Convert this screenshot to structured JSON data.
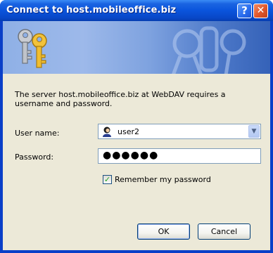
{
  "window": {
    "title": "Connect to host.mobileoffice.biz",
    "help_glyph": "?",
    "close_glyph": "✕"
  },
  "prompt": "The server host.mobileoffice.biz at WebDAV requires a username and password.",
  "form": {
    "username_label": "User name:",
    "username_value": "user2",
    "password_label": "Password:",
    "password_value": "●●●●●●",
    "remember_label": "Remember my password",
    "remember_checked": true,
    "check_glyph": "✓",
    "dropdown_glyph": "▼"
  },
  "buttons": {
    "ok": "OK",
    "cancel": "Cancel"
  },
  "colors": {
    "titlebar": "#0a54dc",
    "client": "#ece9d8",
    "close": "#e0562b",
    "input_border": "#7f9db9"
  }
}
